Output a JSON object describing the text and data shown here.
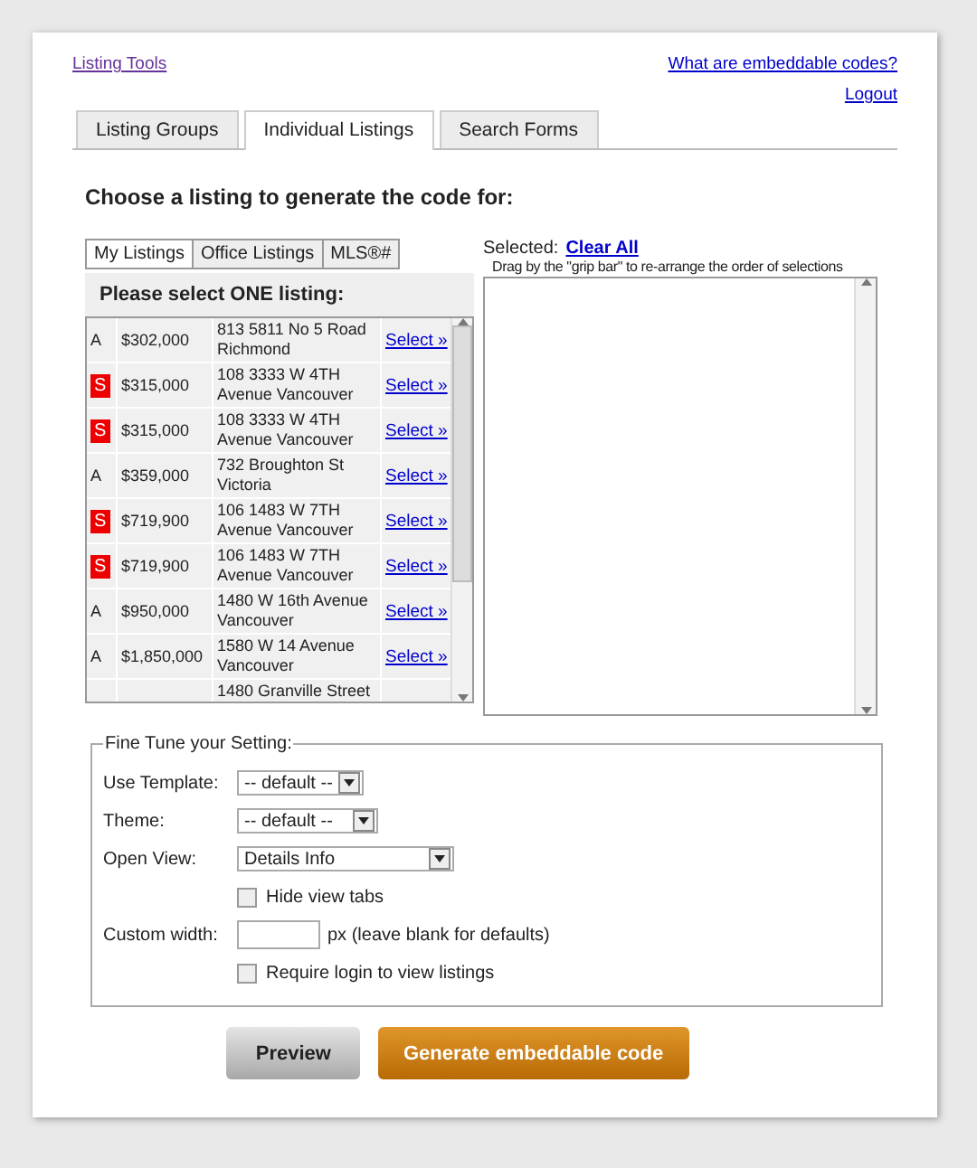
{
  "header": {
    "left_link": "Listing Tools",
    "right_link": "What are embeddable codes?",
    "logout": "Logout"
  },
  "tabs": [
    {
      "label": "Listing Groups",
      "selected": false
    },
    {
      "label": "Individual Listings",
      "selected": true
    },
    {
      "label": "Search Forms",
      "selected": false
    }
  ],
  "heading": "Choose a listing to generate the code for:",
  "listing_tabs": [
    {
      "label": "My Listings",
      "selected": true
    },
    {
      "label": "Office Listings",
      "selected": false
    },
    {
      "label": "MLS®#",
      "selected": false
    }
  ],
  "list_title": "Please select ONE listing:",
  "listings": [
    {
      "status": "A",
      "kind": "plain",
      "price": "$302,000",
      "address": "813 5811 No 5 Road Richmond",
      "action": "Select »"
    },
    {
      "status": "S",
      "kind": "badge",
      "price": "$315,000",
      "address": "108 3333 W 4TH Avenue Vancouver",
      "action": "Select »"
    },
    {
      "status": "S",
      "kind": "badge",
      "price": "$315,000",
      "address": "108 3333 W 4TH Avenue Vancouver",
      "action": "Select »"
    },
    {
      "status": "A",
      "kind": "plain",
      "price": "$359,000",
      "address": "732 Broughton St Victoria",
      "action": "Select »"
    },
    {
      "status": "S",
      "kind": "badge",
      "price": "$719,900",
      "address": "106 1483 W 7TH Avenue Vancouver",
      "action": "Select »"
    },
    {
      "status": "S",
      "kind": "badge",
      "price": "$719,900",
      "address": "106 1483 W 7TH Avenue Vancouver",
      "action": "Select »"
    },
    {
      "status": "A",
      "kind": "plain",
      "price": "$950,000",
      "address": "1480 W 16th Avenue Vancouver",
      "action": "Select »"
    },
    {
      "status": "A",
      "kind": "plain",
      "price": "$1,850,000",
      "address": "1580 W 14 Avenue Vancouver",
      "action": "Select »"
    },
    {
      "address": "1480 Granville Street",
      "kind": "partial"
    }
  ],
  "selected_panel": {
    "label": "Selected:",
    "clear": "Clear All",
    "hint": "Drag by the \"grip bar\" to re-arrange the order of selections"
  },
  "settings": {
    "legend": "Fine Tune your Setting:",
    "template": {
      "label": "Use Template:",
      "value": "-- default --"
    },
    "theme": {
      "label": "Theme:",
      "value": "-- default --"
    },
    "open_view": {
      "label": "Open View:",
      "value": "Details Info"
    },
    "hide_tabs": {
      "label": "Hide view tabs",
      "checked": false
    },
    "width": {
      "label": "Custom width:",
      "unit": "px (leave blank for defaults)"
    },
    "require_login": {
      "label": "Require login to view listings",
      "checked": false
    }
  },
  "buttons": {
    "preview": "Preview",
    "generate": "Generate embeddable code"
  }
}
